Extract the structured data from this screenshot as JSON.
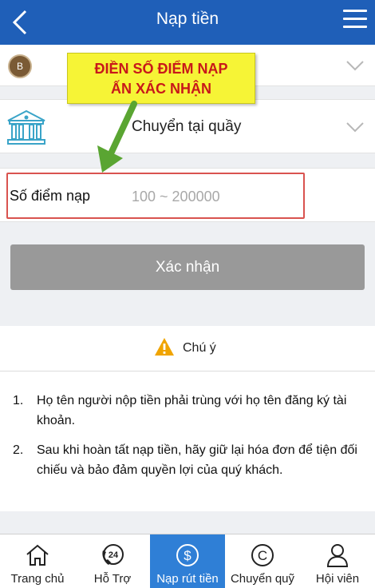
{
  "header": {
    "title": "Nạp tiền",
    "back_icon": "chevron-left-icon",
    "menu_icon": "hamburger-menu-icon"
  },
  "account": {
    "avatar_letter": "B"
  },
  "method": {
    "label": "Chuyển tại quầy",
    "icon": "bank-icon"
  },
  "amount": {
    "label": "Số điểm nạp",
    "placeholder": "100 ~ 200000",
    "value": ""
  },
  "confirm": {
    "label": "Xác nhận"
  },
  "callout": {
    "line1": "ĐIỀN SỐ ĐIỂM NẠP",
    "line2": "ẤN XÁC NHẬN"
  },
  "note": {
    "title": "Chú ý",
    "items": [
      {
        "num": "1.",
        "text": "Họ tên người nộp tiền phải trùng với họ tên đăng ký tài khoản."
      },
      {
        "num": "2.",
        "text": "Sau khi hoàn tất nạp tiền, hãy giữ lại hóa đơn để tiện đối chiếu và bảo đảm quyền lợi của quý khách."
      }
    ]
  },
  "nav": [
    {
      "label": "Trang chủ",
      "icon": "home-icon"
    },
    {
      "label": "Hỗ Trợ",
      "icon": "support-24-icon"
    },
    {
      "label": "Nạp rút tiền",
      "icon": "dollar-coin-icon",
      "active": true
    },
    {
      "label": "Chuyển quỹ",
      "icon": "transfer-c-icon"
    },
    {
      "label": "Hội viên",
      "icon": "user-icon"
    }
  ],
  "colors": {
    "header": "#1f5fb8",
    "active_nav": "#2f7fd6",
    "callout_bg": "#f6f436",
    "callout_text": "#c8181a",
    "highlight": "#d9534f",
    "arrow": "#5aa532"
  }
}
